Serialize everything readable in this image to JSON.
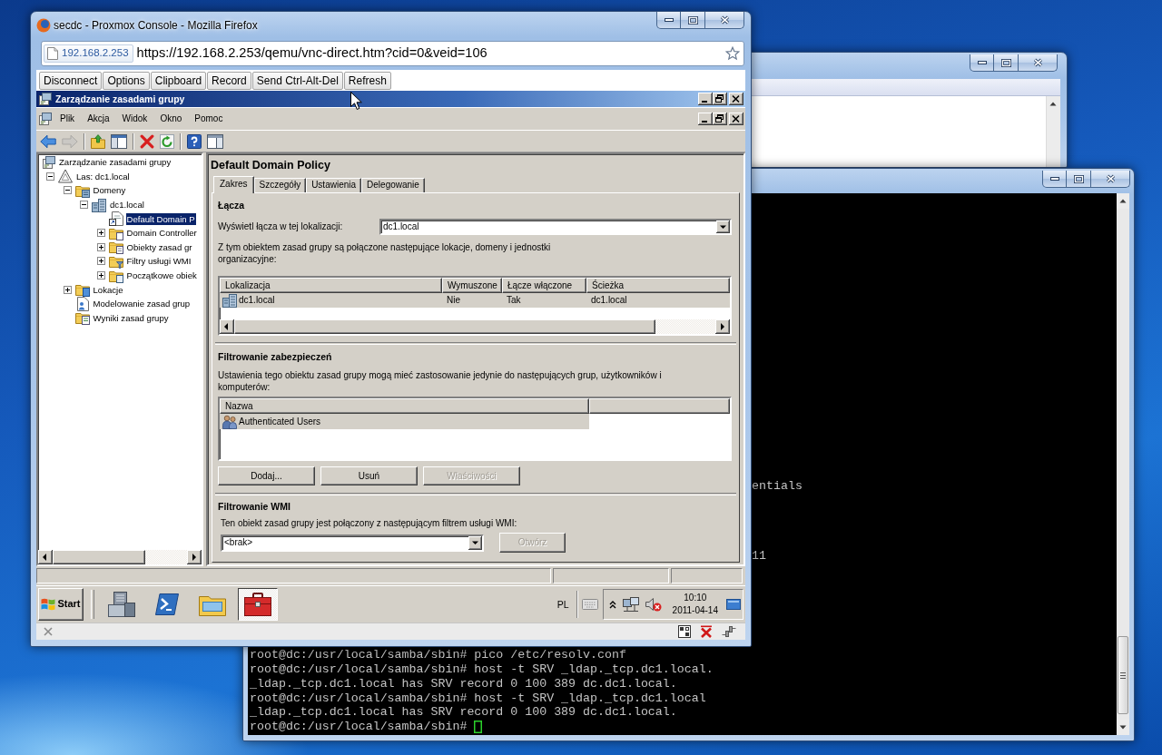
{
  "browser": {
    "title": "secdc - Proxmox Console - Mozilla Firefox",
    "site_identity": "192.168.2.253",
    "url": "https://192.168.2.253/qemu/vnc-direct.htm?cid=0&veid=106",
    "applet_buttons": [
      "Disconnect",
      "Options",
      "Clipboard",
      "Record",
      "Send Ctrl-Alt-Del",
      "Refresh"
    ]
  },
  "gpmc": {
    "title": "Zarządzanie zasadami grupy",
    "menu": [
      "Plik",
      "Akcja",
      "Widok",
      "Okno",
      "Pomoc"
    ],
    "toolbar_groups": [
      [
        {
          "kind": "back",
          "disabled": false
        },
        {
          "kind": "forward",
          "disabled": true
        }
      ],
      [
        {
          "kind": "up",
          "disabled": false
        },
        {
          "kind": "tree",
          "disabled": false
        }
      ],
      [
        {
          "kind": "delete",
          "disabled": false
        },
        {
          "kind": "refresh",
          "disabled": false
        }
      ],
      [
        {
          "kind": "help",
          "disabled": false
        },
        {
          "kind": "pane",
          "disabled": false
        }
      ]
    ],
    "tree": [
      {
        "label": "Zarządzanie zasadami grupy",
        "kind": "console",
        "selected": false,
        "children": [
          {
            "label": "Las: dc1.local",
            "kind": "forest",
            "selected": false,
            "expanded": true,
            "children": [
              {
                "label": "Domeny",
                "kind": "domains",
                "selected": false,
                "expanded": true,
                "children": [
                  {
                    "label": "dc1.local",
                    "kind": "domain",
                    "selected": false,
                    "expanded": true,
                    "children": [
                      {
                        "label": "Default Domain P",
                        "kind": "gpo-link",
                        "selected": true
                      },
                      {
                        "label": "Domain Controller",
                        "kind": "ou",
                        "selected": false,
                        "expanded": false
                      },
                      {
                        "label": "Obiekty zasad gr",
                        "kind": "gpo-folder",
                        "selected": false,
                        "expanded": false
                      },
                      {
                        "label": "Filtry usługi WMI",
                        "kind": "wmi",
                        "selected": false,
                        "expanded": false
                      },
                      {
                        "label": "Początkowe obiek",
                        "kind": "starter",
                        "selected": false,
                        "expanded": false
                      }
                    ]
                  }
                ]
              },
              {
                "label": "Lokacje",
                "kind": "sites",
                "selected": false,
                "expanded": false
              },
              {
                "label": "Modelowanie zasad grup",
                "kind": "modeling",
                "selected": false
              },
              {
                "label": "Wyniki zasad grupy",
                "kind": "results",
                "selected": false
              }
            ]
          }
        ]
      }
    ],
    "details": {
      "title": "Default Domain Policy",
      "tabs": [
        {
          "label": "Zakres",
          "selected": true
        },
        {
          "label": "Szczegóły",
          "selected": false
        },
        {
          "label": "Ustawienia",
          "selected": false
        },
        {
          "label": "Delegowanie",
          "selected": false
        }
      ],
      "links": {
        "heading": "Łącza",
        "location_label": "Wyświetl łącza w tej lokalizacji:",
        "location_value": "dc1.local",
        "description": "Z tym obiektem zasad grupy są połączone następujące lokacje, domeny i jednostki organizacyjne:",
        "columns": [
          "Lokalizacja",
          "Wymuszone",
          "Łącze włączone",
          "Ścieżka"
        ],
        "rows": [
          {
            "kind": "domain",
            "cells": [
              "dc1.local",
              "Nie",
              "Tak",
              "dc1.local"
            ],
            "selected": true
          }
        ]
      },
      "security": {
        "heading": "Filtrowanie zabezpieczeń",
        "description": "Ustawienia tego obiektu zasad grupy mogą mieć zastosowanie jedynie do następujących grup, użytkowników i komputerów:",
        "columns": [
          "Nazwa"
        ],
        "rows": [
          {
            "kind": "group",
            "cells": [
              "Authenticated Users"
            ],
            "selected": true
          }
        ],
        "buttons": [
          {
            "label": "Dodaj...",
            "disabled": false
          },
          {
            "label": "Usuń",
            "disabled": false
          },
          {
            "label": "Właściwości",
            "disabled": true
          }
        ]
      },
      "wmi": {
        "heading": "Filtrowanie WMI",
        "description": "Ten obiekt zasad grupy jest połączony z następującym filtrem usługi WMI:",
        "filter_value": "<brak>",
        "open_button": {
          "label": "Otwórz",
          "disabled": true
        }
      }
    }
  },
  "taskbar": {
    "start": "Start",
    "tasks": [
      {
        "kind": "server",
        "selected": false
      },
      {
        "kind": "powershell",
        "selected": false
      },
      {
        "kind": "explorer",
        "selected": false
      },
      {
        "kind": "toolbox",
        "selected": true
      }
    ],
    "language": "PL",
    "time": "10:10",
    "date": "2011-04-14"
  },
  "terminal": {
    "fragments": [
      "entials",
      "11"
    ],
    "lines": [
      "root@dc:/usr/local/samba/sbin# pico /etc/resolv.conf",
      "root@dc:/usr/local/samba/sbin# host -t SRV _ldap._tcp.dc1.local.",
      "_ldap._tcp.dc1.local has SRV record 0 100 389 dc.dc1.local.",
      "root@dc:/usr/local/samba/sbin# host -t SRV _ldap._tcp.dc1.local",
      "_ldap._tcp.dc1.local has SRV record 0 100 389 dc.dc1.local.",
      "root@dc:/usr/local/samba/sbin#"
    ]
  }
}
